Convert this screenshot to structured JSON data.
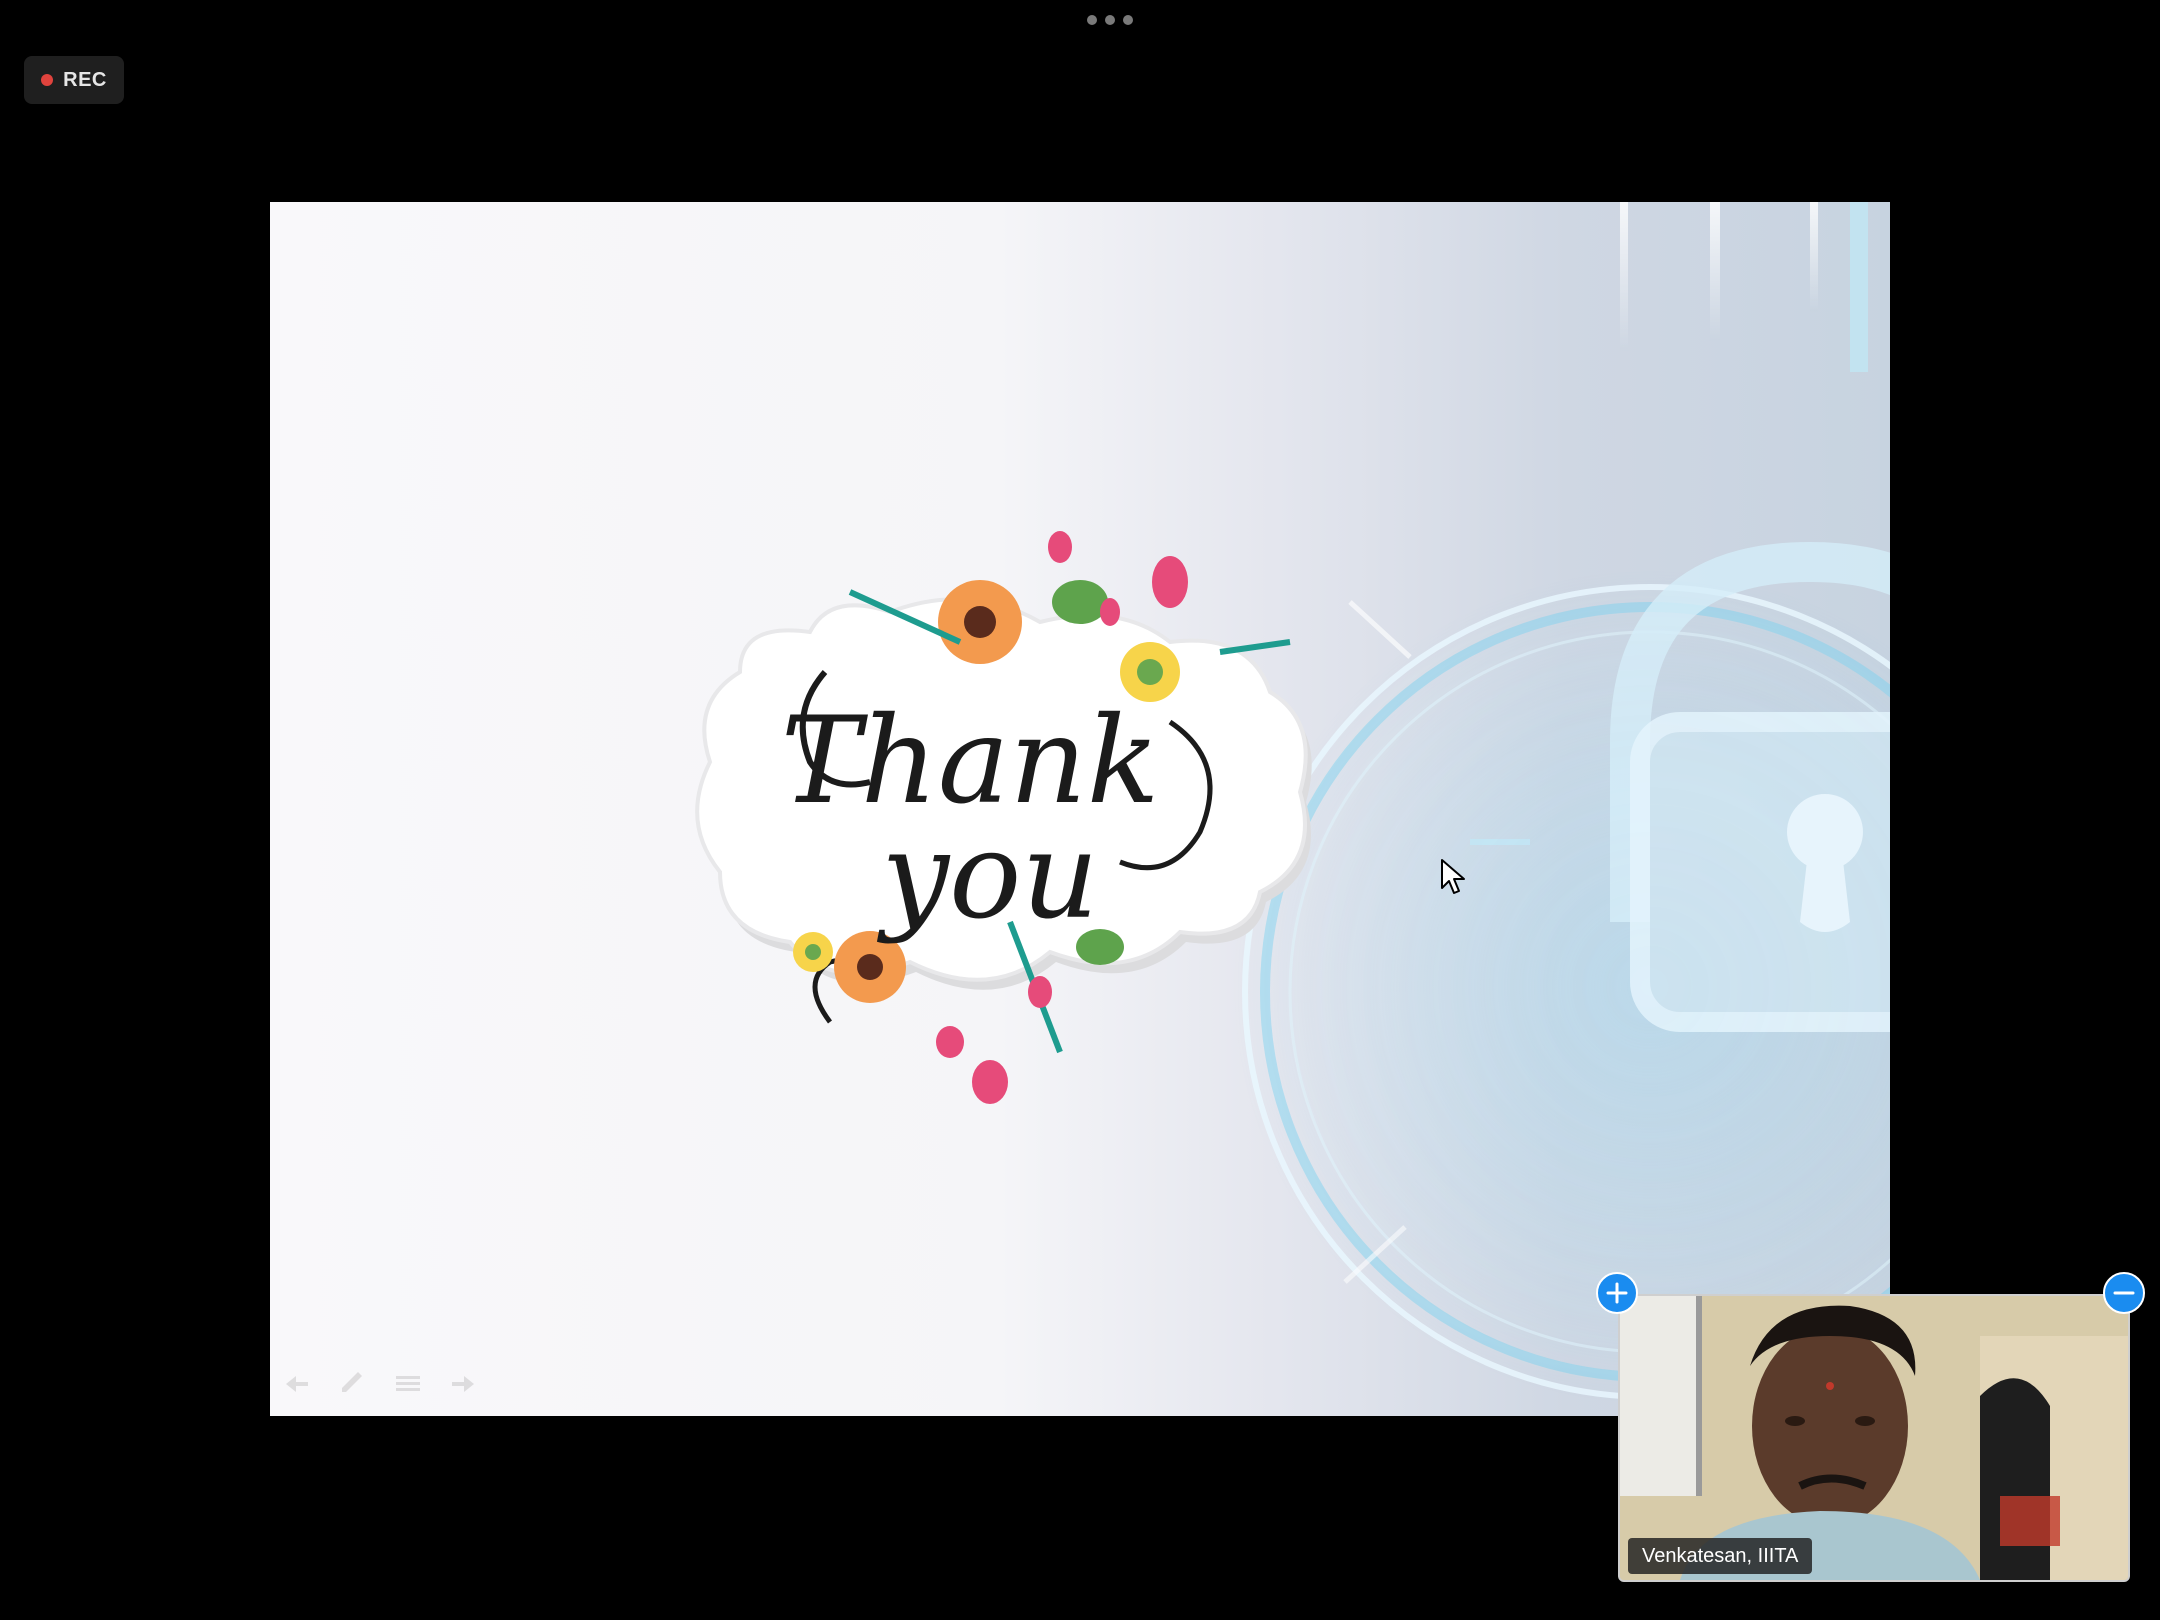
{
  "top_bar": {
    "more_icon": "more-horizontal-icon"
  },
  "recording": {
    "label": "REC",
    "dot_color": "#e0433d"
  },
  "slide": {
    "heading_line1": "Thank",
    "heading_line2": "you",
    "background_icon": "padlock-icon"
  },
  "participant": {
    "name": "Venkatesan, IIITA",
    "add_icon": "plus-icon",
    "minimize_icon": "minus-icon"
  },
  "colors": {
    "accent": "#1a8cf0",
    "rec": "#e0433d",
    "background": "#000000"
  }
}
